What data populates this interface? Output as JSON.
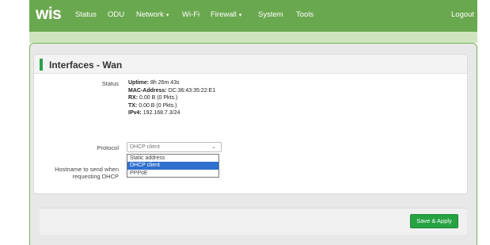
{
  "brand": "wis",
  "nav": {
    "items": [
      {
        "label": "Status",
        "caret": ""
      },
      {
        "label": "ODU",
        "caret": ""
      },
      {
        "label": "Network",
        "caret": "▾"
      },
      {
        "label": "Wi-Fi",
        "caret": ""
      },
      {
        "label": "Firewall",
        "caret": "▾"
      },
      {
        "label": "System",
        "caret": ""
      },
      {
        "label": "Tools",
        "caret": ""
      }
    ],
    "logout": "Logout"
  },
  "page": {
    "title": "Interfaces - Wan"
  },
  "status": {
    "label": "Status",
    "uptime_key": "Uptime:",
    "uptime_val": "8h 26m 43s",
    "mac_key": "MAC-Address:",
    "mac_val": "DC:36:43:35:22:E1",
    "rx_key": "RX:",
    "rx_val": "0.00 B (0 Pkts.)",
    "tx_key": "TX:",
    "tx_val": "0.00 B (0 Pkts.)",
    "ipv4_key": "IPv4:",
    "ipv4_val": "192.168.7.3/24"
  },
  "protocol": {
    "label": "Protocol",
    "selected": "DHCP client",
    "options": [
      "Static address",
      "DHCP client",
      "PPPoE"
    ],
    "selected_index": 1
  },
  "hostname": {
    "label_line1": "Hostname to send when",
    "label_line2": "requesting DHCP"
  },
  "actions": {
    "save_apply": "Save & Apply"
  },
  "colors": {
    "navbar": "#6aa84f",
    "accent": "#27a243",
    "selection": "#2f6fcf"
  },
  "icons": {
    "chevron": "chevron-down-icon",
    "caret": "caret-down-icon"
  }
}
